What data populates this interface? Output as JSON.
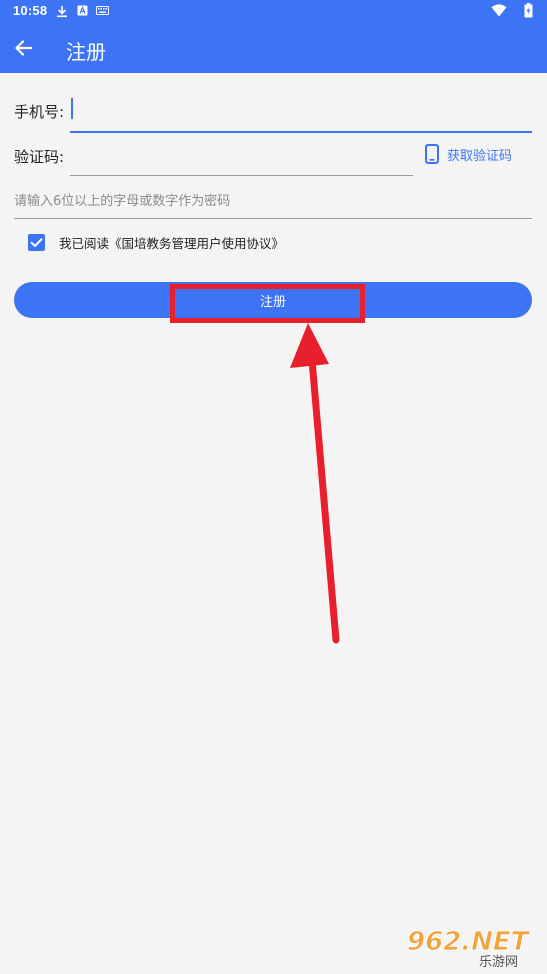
{
  "status_bar": {
    "time": "10:58"
  },
  "header": {
    "title": "注册",
    "accent_color": "#3d73f5"
  },
  "form": {
    "phone_label": "手机号:",
    "phone_value": "",
    "code_label": "验证码:",
    "code_value": "",
    "get_code_label": "获取验证码",
    "password_placeholder": "请输入6位以上的字母或数字作为密码",
    "agreement_text": "我已阅读《国培教务管理用户使用协议》",
    "agreement_checked": true,
    "register_label": "注册"
  },
  "annotation": {
    "highlight_color": "#e8202d"
  },
  "watermark": {
    "brand": "962.NET",
    "sub": "乐游网"
  },
  "icons": [
    "download-icon",
    "a-notification-icon",
    "keyboard-icon",
    "wifi-icon",
    "battery-charging-icon",
    "back-arrow-icon",
    "phone-icon",
    "check-icon"
  ]
}
